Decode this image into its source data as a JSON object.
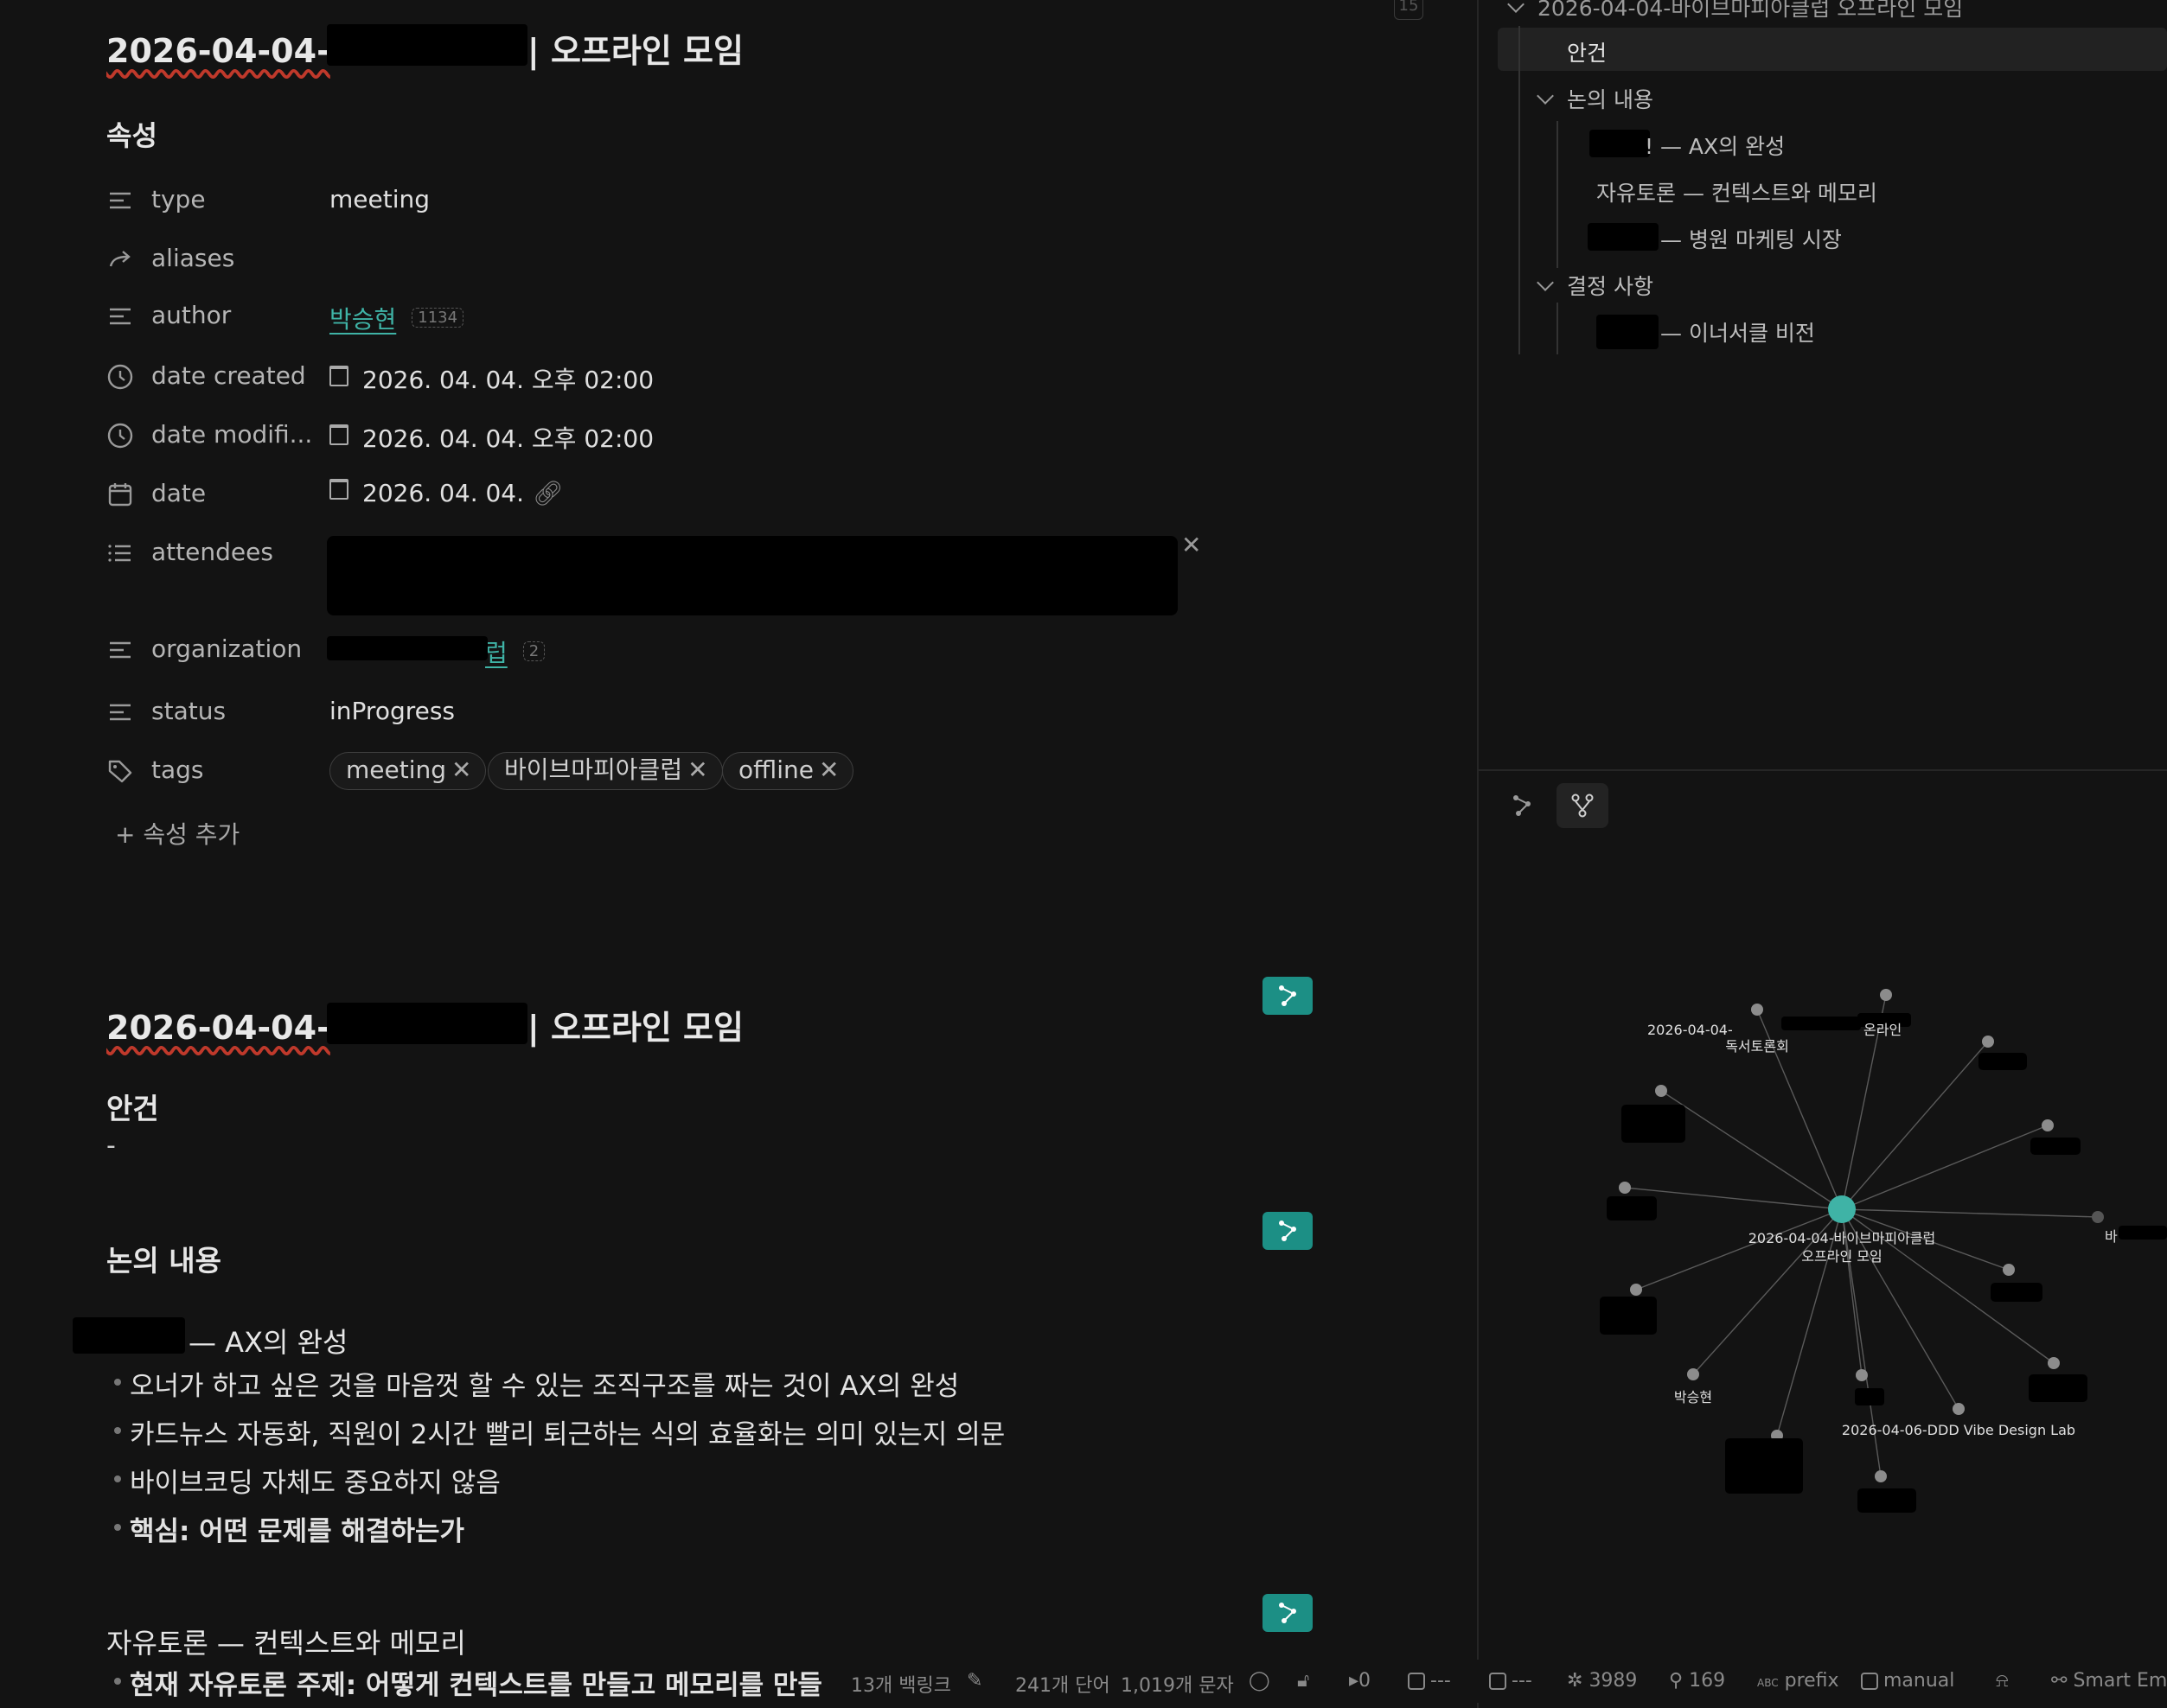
{
  "note": {
    "title_prefix": "2026-04-04-",
    "title_suffix": "| 오프라인 모임",
    "tab_hint": "15"
  },
  "properties": {
    "heading": "속성",
    "rows": [
      {
        "key": "type",
        "value": "meeting"
      },
      {
        "key": "aliases",
        "value": ""
      },
      {
        "key": "author",
        "value": "박승현",
        "count": "1134"
      },
      {
        "key": "date created",
        "value": "2026. 04. 04. 오후 02:00"
      },
      {
        "key": "date modifi...",
        "value": "2026. 04. 04. 오후 02:00"
      },
      {
        "key": "date",
        "value": "2026. 04. 04."
      },
      {
        "key": "attendees",
        "value": ""
      },
      {
        "key": "organization",
        "value": "럽",
        "count": "2"
      },
      {
        "key": "status",
        "value": "inProgress"
      },
      {
        "key": "tags",
        "value": ""
      }
    ],
    "tags": [
      "meeting",
      "바이브마피아클럽",
      "offline"
    ],
    "add_label": "+ 속성 추가"
  },
  "body": {
    "agenda_heading": "안건",
    "agenda_text": "-",
    "discussion_heading": "논의 내용",
    "sub1_title": "— AX의 완성",
    "sub1_bullets": [
      "오너가 하고 싶은 것을 마음껏 할 수 있는 조직구조를 짜는 것이 AX의 완성",
      "카드뉴스 자동화, 직원이 2시간 빨리 퇴근하는 식의 효율화는 의미 있는지 의문",
      "바이브코딩 자체도 중요하지 않음",
      "핵심: 어떤 문제를 해결하는가"
    ],
    "sub2_title": "자유토론 — 컨텍스트와 메모리",
    "sub2_bullet": "현재 자유토론 주제: 어떻게 컨텍스트를 만들고 메모리를 만들"
  },
  "outline": {
    "root": "2026-04-04-바이브마피아클럽 오프라인 모임",
    "items": [
      {
        "label": "안건",
        "level": 1
      },
      {
        "label": "논의 내용",
        "level": 1
      },
      {
        "label": "! — AX의 완성",
        "level": 2
      },
      {
        "label": "자유토론 — 컨텍스트와 메모리",
        "level": 2
      },
      {
        "label": "— 병원 마케팅 시장",
        "level": 2
      },
      {
        "label": "결정 사항",
        "level": 1
      },
      {
        "label": "— 이너서클 비전",
        "level": 2
      }
    ]
  },
  "graph": {
    "center_label_1": "2026-04-04-바이브마피아클럽",
    "center_label_2": "오프라인 모임",
    "labels": {
      "n1a": "2026-04-04-",
      "n1b": "온라인",
      "n1c": "독서토론회",
      "author": "박승현",
      "vibe": "2026-04-06-DDD Vibe Design Lab",
      "right": "바"
    }
  },
  "statusbar": {
    "backlinks": "13개 백링크",
    "words": "241개 단어",
    "chars": "1,019개 문자",
    "zero": "0",
    "dash1": "---",
    "dash2": "---",
    "graph_count": "3989",
    "link_count": "169",
    "prefix": "prefix",
    "manual": "manual",
    "smart": "Smart Em"
  },
  "colors": {
    "accent_teal": "#1c8f85",
    "node_teal": "#3fb3a6",
    "background": "#131313"
  }
}
